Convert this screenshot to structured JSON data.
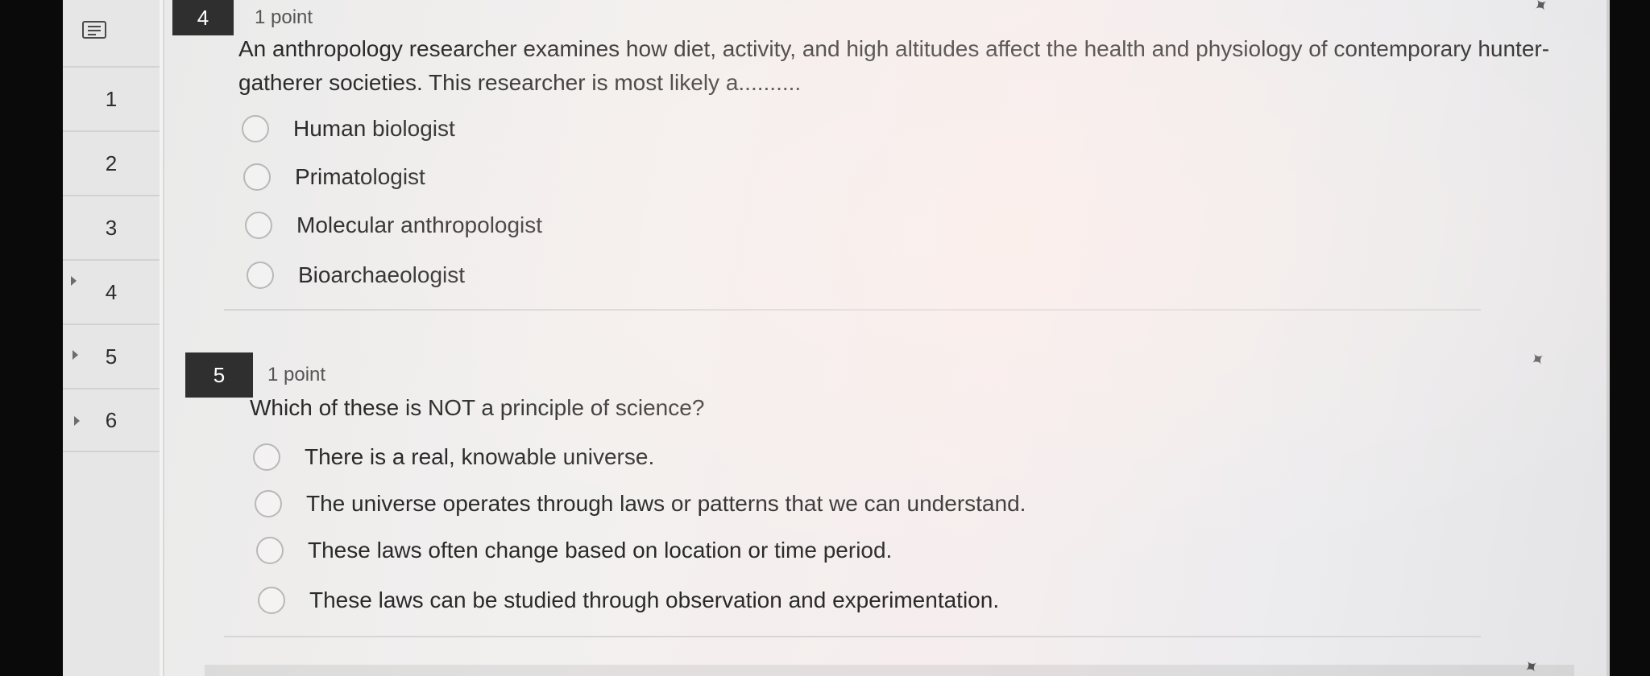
{
  "sidebar": {
    "icon": "list-icon",
    "items": [
      "1",
      "2",
      "3",
      "4",
      "5",
      "6"
    ]
  },
  "questions": [
    {
      "number": "4",
      "points": "1 point",
      "text": "An anthropology researcher examines how diet, activity, and high altitudes affect the health and physiology of contemporary hunter-gatherer societies. This researcher is most likely a..........",
      "text_line1": "An anthropology researcher examines how diet, activity, and high altitudes affect the health and physiology of contemporary hunter-",
      "text_line2": "gatherer societies. This researcher is most likely a..........",
      "options": [
        "Human biologist",
        "Primatologist",
        "Molecular anthropologist",
        "Bioarchaeologist"
      ]
    },
    {
      "number": "5",
      "points": "1 point",
      "text": "Which of these is NOT a principle of science?",
      "options": [
        "There is a real, knowable universe.",
        "The universe operates through laws or patterns that we can understand.",
        "These laws often change based on location or time period.",
        "These laws can be studied through observation and experimentation."
      ]
    }
  ],
  "colors": {
    "badge": "#2f2f2f",
    "text": "#2a2a2a",
    "radio_border": "#b8b8b8"
  }
}
